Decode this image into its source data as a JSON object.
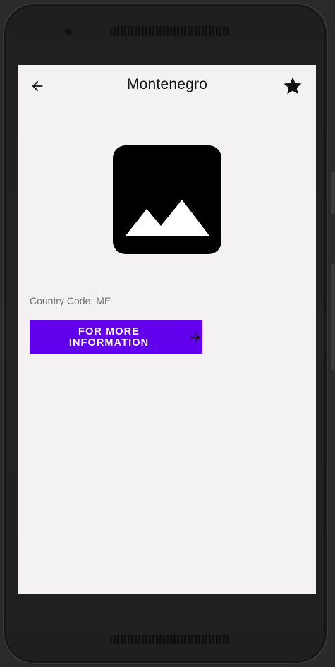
{
  "toolbar": {
    "title": "Montenegro",
    "back_icon": "arrow-back-icon",
    "favorite_icon": "star-icon"
  },
  "country": {
    "flag_icon": "image-placeholder-icon",
    "code_label": "Country Code:",
    "code_value": "ME"
  },
  "actions": {
    "more_info_label": "FOR MORE INFORMATION",
    "more_info_icon": "arrow-forward-icon"
  },
  "colors": {
    "accent": "#6200ee",
    "screen_background": "#f3f1f2",
    "device_frame": "#1f1f1f"
  }
}
